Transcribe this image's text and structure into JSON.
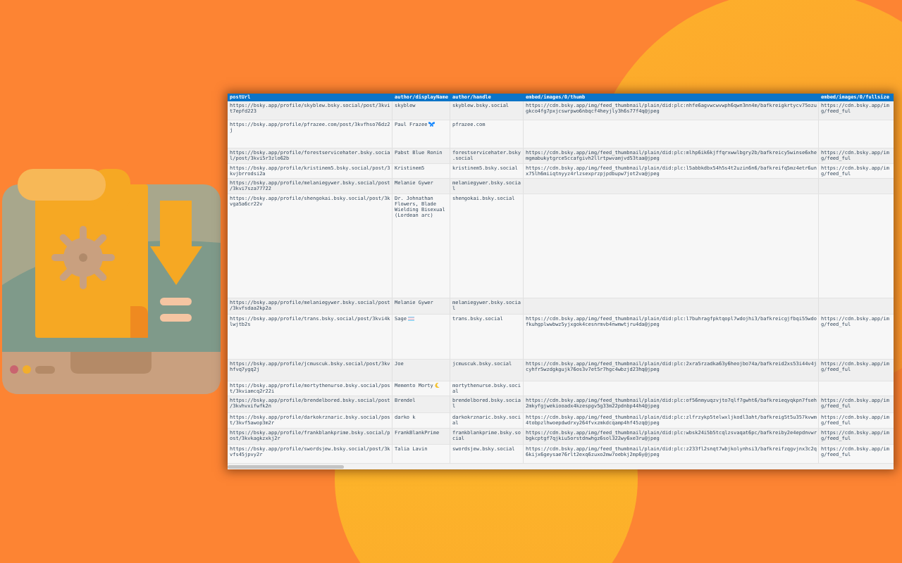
{
  "table": {
    "columns": [
      "postUrl",
      "author/displayName",
      "author/handle",
      "embed/images/0/thumb",
      "embed/images/0/fullsize"
    ],
    "rows": [
      {
        "post_url": "https://bsky.app/profile/skyblew.bsky.social/post/3kvit7epfd223",
        "display_name": "skyblew",
        "handle": "skyblew.bsky.social",
        "thumb": "https://cdn.bsky.app/img/feed_thumbnail/plain/did:plc:nhfe6agvwcwvwph6qwn3nn4m/bafkreigkrtycv75ozugkco4fg7pxjcswrpwo6nbqcf4heyjly3h6s77f4q@jpeg",
        "fullsize": "https://cdn.bsky.app/img/feed_ful"
      },
      {
        "post_url": "https://bsky.app/profile/pfrazee.com/post/3kvfhso76dz2j",
        "display_name": "Paul Frazee",
        "emoji": {
          "kind": "butterfly"
        },
        "handle": "pfrazee.com"
      },
      {
        "post_url": "https://bsky.app/profile/forestservicehater.bsky.social/post/3kvi5r3zlo62b",
        "display_name": "Pabst Blue Ronin",
        "handle": "forestservicehater.bsky.social",
        "thumb": "https://cdn.bsky.app/img/feed_thumbnail/plain/did:plc:mlhp6ik6kjffqrxwwlbgry2b/bafkreicy5winse6xhemgmabukytgrce5ccafgivh2llrtpwvamjvd53taa@jpeg",
        "fullsize": "https://cdn.bsky.app/img/feed_ful"
      },
      {
        "post_url": "https://bsky.app/profile/kristinem5.bsky.social/post/3kvjbrrodsi2a",
        "display_name": "Kristinem5",
        "handle": "kristinem5.bsky.social",
        "thumb": "https://cdn.bsky.app/img/feed_thumbnail/plain/did:plc:l5abbkdbx54h5s4t2uzin6n6/bafkreifq5mz4etr6unx75lh6miiqtnyyz4rlzsexprzpjpdbupw7jot2va@jpeg",
        "fullsize": "https://cdn.bsky.app/img/feed_ful"
      },
      {
        "post_url": "https://bsky.app/profile/melaniegywer.bsky.social/post/3kvi7sza77722",
        "display_name": "Melanie Gywer",
        "handle": "melaniegywer.bsky.social"
      },
      {
        "post_url": "https://bsky.app/profile/shengokai.bsky.social/post/3kvga5a6cr22v",
        "display_name": "Dr. Johnathan Flowers, Blade Wielding Bisexual (Lordean arc)",
        "handle": "shengokai.bsky.social"
      },
      {
        "post_url": "https://bsky.app/profile/melaniegywer.bsky.social/post/3kvfsdaa2kp2a",
        "display_name": "Melanie Gywer",
        "handle": "melaniegywer.bsky.social"
      },
      {
        "post_url": "https://bsky.app/profile/trans.bsky.social/post/3kvi4klwjtb2s",
        "display_name": "Sage",
        "emoji": {
          "kind": "flag"
        },
        "handle": "trans.bsky.social",
        "thumb": "https://cdn.bsky.app/img/feed_thumbnail/plain/did:plc:l7buhragfpktqopl7wdojhi3/bafkreicgjfbqi55wdofkuhgplwwbwz5yjxgok4cesnrmvb4nwmwtjru4da@jpeg",
        "fullsize": "https://cdn.bsky.app/img/feed_ful"
      },
      {
        "post_url": "https://bsky.app/profile/jcmuscuk.bsky.social/post/3kvhfvq7ygq2j",
        "display_name": "Joe",
        "handle": "jcmuscuk.bsky.social",
        "thumb": "https://cdn.bsky.app/img/feed_thumbnail/plain/did:plc:2xra5rzadka63y6heojbo74a/bafkreid2xs53i44v4jcyhfr5wzdgkgujk76os3v7et5r7hgc4wbzjd23hq@jpeg",
        "fullsize": "https://cdn.bsky.app/img/feed_ful"
      },
      {
        "post_url": "https://bsky.app/profile/mortythenurse.bsky.social/post/3kviamcq2r22i",
        "display_name": "Memento Morty",
        "emoji": {
          "kind": "moon"
        },
        "handle": "mortythenurse.bsky.social"
      },
      {
        "post_url": "https://bsky.app/profile/brendelbored.bsky.social/post/3kvhvxifwfk2n",
        "display_name": "Brendel",
        "handle": "brendelbored.bsky.social",
        "thumb": "https://cdn.bsky.app/img/feed_thumbnail/plain/did:plc:of56nmyuqzvjto7qlf7gwht6/bafkreieqyqkpn7fseh2mkyfgjwekiooadx4kzespgv5g33m22pdnbp44h4@jpeg",
        "fullsize": "https://cdn.bsky.app/img/feed_ful"
      },
      {
        "post_url": "https://bsky.app/profile/darkokrznaric.bsky.social/post/3kvf5awop3m2r",
        "display_name": "darko k",
        "handle": "darkokrznaric.bsky.social",
        "thumb": "https://cdn.bsky.app/img/feed_thumbnail/plain/did:plc:zlfrzykp5telwxljkodl3aht/bafkreig5t5u357kvwm4tobpzlhwoepdwdrxy264fvxzmkdcqamp4hf45zq@jpeg",
        "fullsize": "https://cdn.bsky.app/img/feed_ful"
      },
      {
        "post_url": "https://bsky.app/profile/frankblankprime.bsky.social/post/3kvkagkzxkj2r",
        "display_name": "FrankBlankPrime",
        "handle": "frankblankprime.bsky.social",
        "thumb": "https://cdn.bsky.app/img/feed_thumbnail/plain/did:plc:wbsk24i5b5tcqlzsvaqat6pc/bafkreiby2e4epdnvwrbgkcptgf7qjkiu5orstdnwhgz6sol322wy6xe3ru@jpeg",
        "fullsize": "https://cdn.bsky.app/img/feed_ful"
      },
      {
        "post_url": "https://bsky.app/profile/swordsjew.bsky.social/post/3kvfs45jpvy2r",
        "display_name": "Talia Lavin",
        "handle": "swordsjew.bsky.social",
        "thumb": "https://cdn.bsky.app/img/feed_thumbnail/plain/did:plc:z233fl2snqt7wbjkolynhsi3/bafkreifzqgvjnx3c2q6kijx6geysae76rlt2exq6zuxo2mw7oebkj2mp6y@jpeg",
        "fullsize": "https://cdn.bsky.app/img/feed_ful"
      }
    ]
  }
}
